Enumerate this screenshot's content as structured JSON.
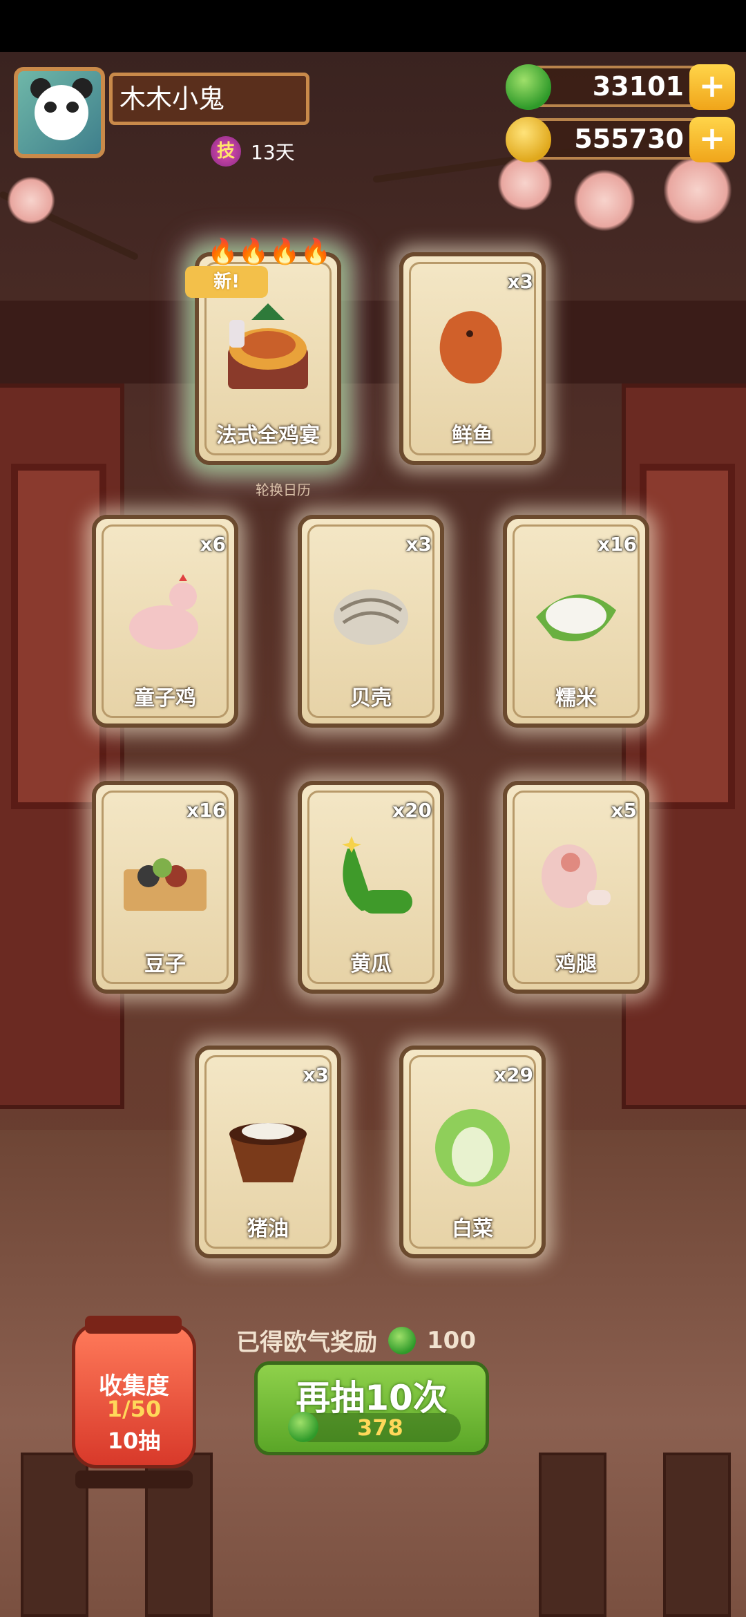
{
  "player": {
    "name": "木木小鬼",
    "skill_badge": "技",
    "skill_days": "13天"
  },
  "currency": {
    "jade": "33101",
    "coins": "555730",
    "plus": "+"
  },
  "special_card": {
    "label": "法式全鸡宴",
    "new_tag": "新!",
    "flames": "🔥🔥🔥🔥🔥"
  },
  "calendar_label": "轮换日历",
  "cards": [
    {
      "label": "鲜鱼",
      "count": "x3"
    },
    {
      "label": "童子鸡",
      "count": "x6"
    },
    {
      "label": "贝壳",
      "count": "x3"
    },
    {
      "label": "糯米",
      "count": "x16"
    },
    {
      "label": "豆子",
      "count": "x16"
    },
    {
      "label": "黄瓜",
      "count": "x20"
    },
    {
      "label": "鸡腿",
      "count": "x5"
    },
    {
      "label": "猪油",
      "count": "x3"
    },
    {
      "label": "白菜",
      "count": "x29"
    }
  ],
  "collection": {
    "title": "收集度",
    "progress": "1/50",
    "draws": "10抽"
  },
  "reward": {
    "text": "已得欧气奖励",
    "value": "100"
  },
  "draw_button": {
    "label": "再抽10次",
    "cost": "378"
  },
  "colors": {
    "jade": "#2f9a2a",
    "gold": "#f0a51a",
    "button_green": "#5aa627"
  }
}
